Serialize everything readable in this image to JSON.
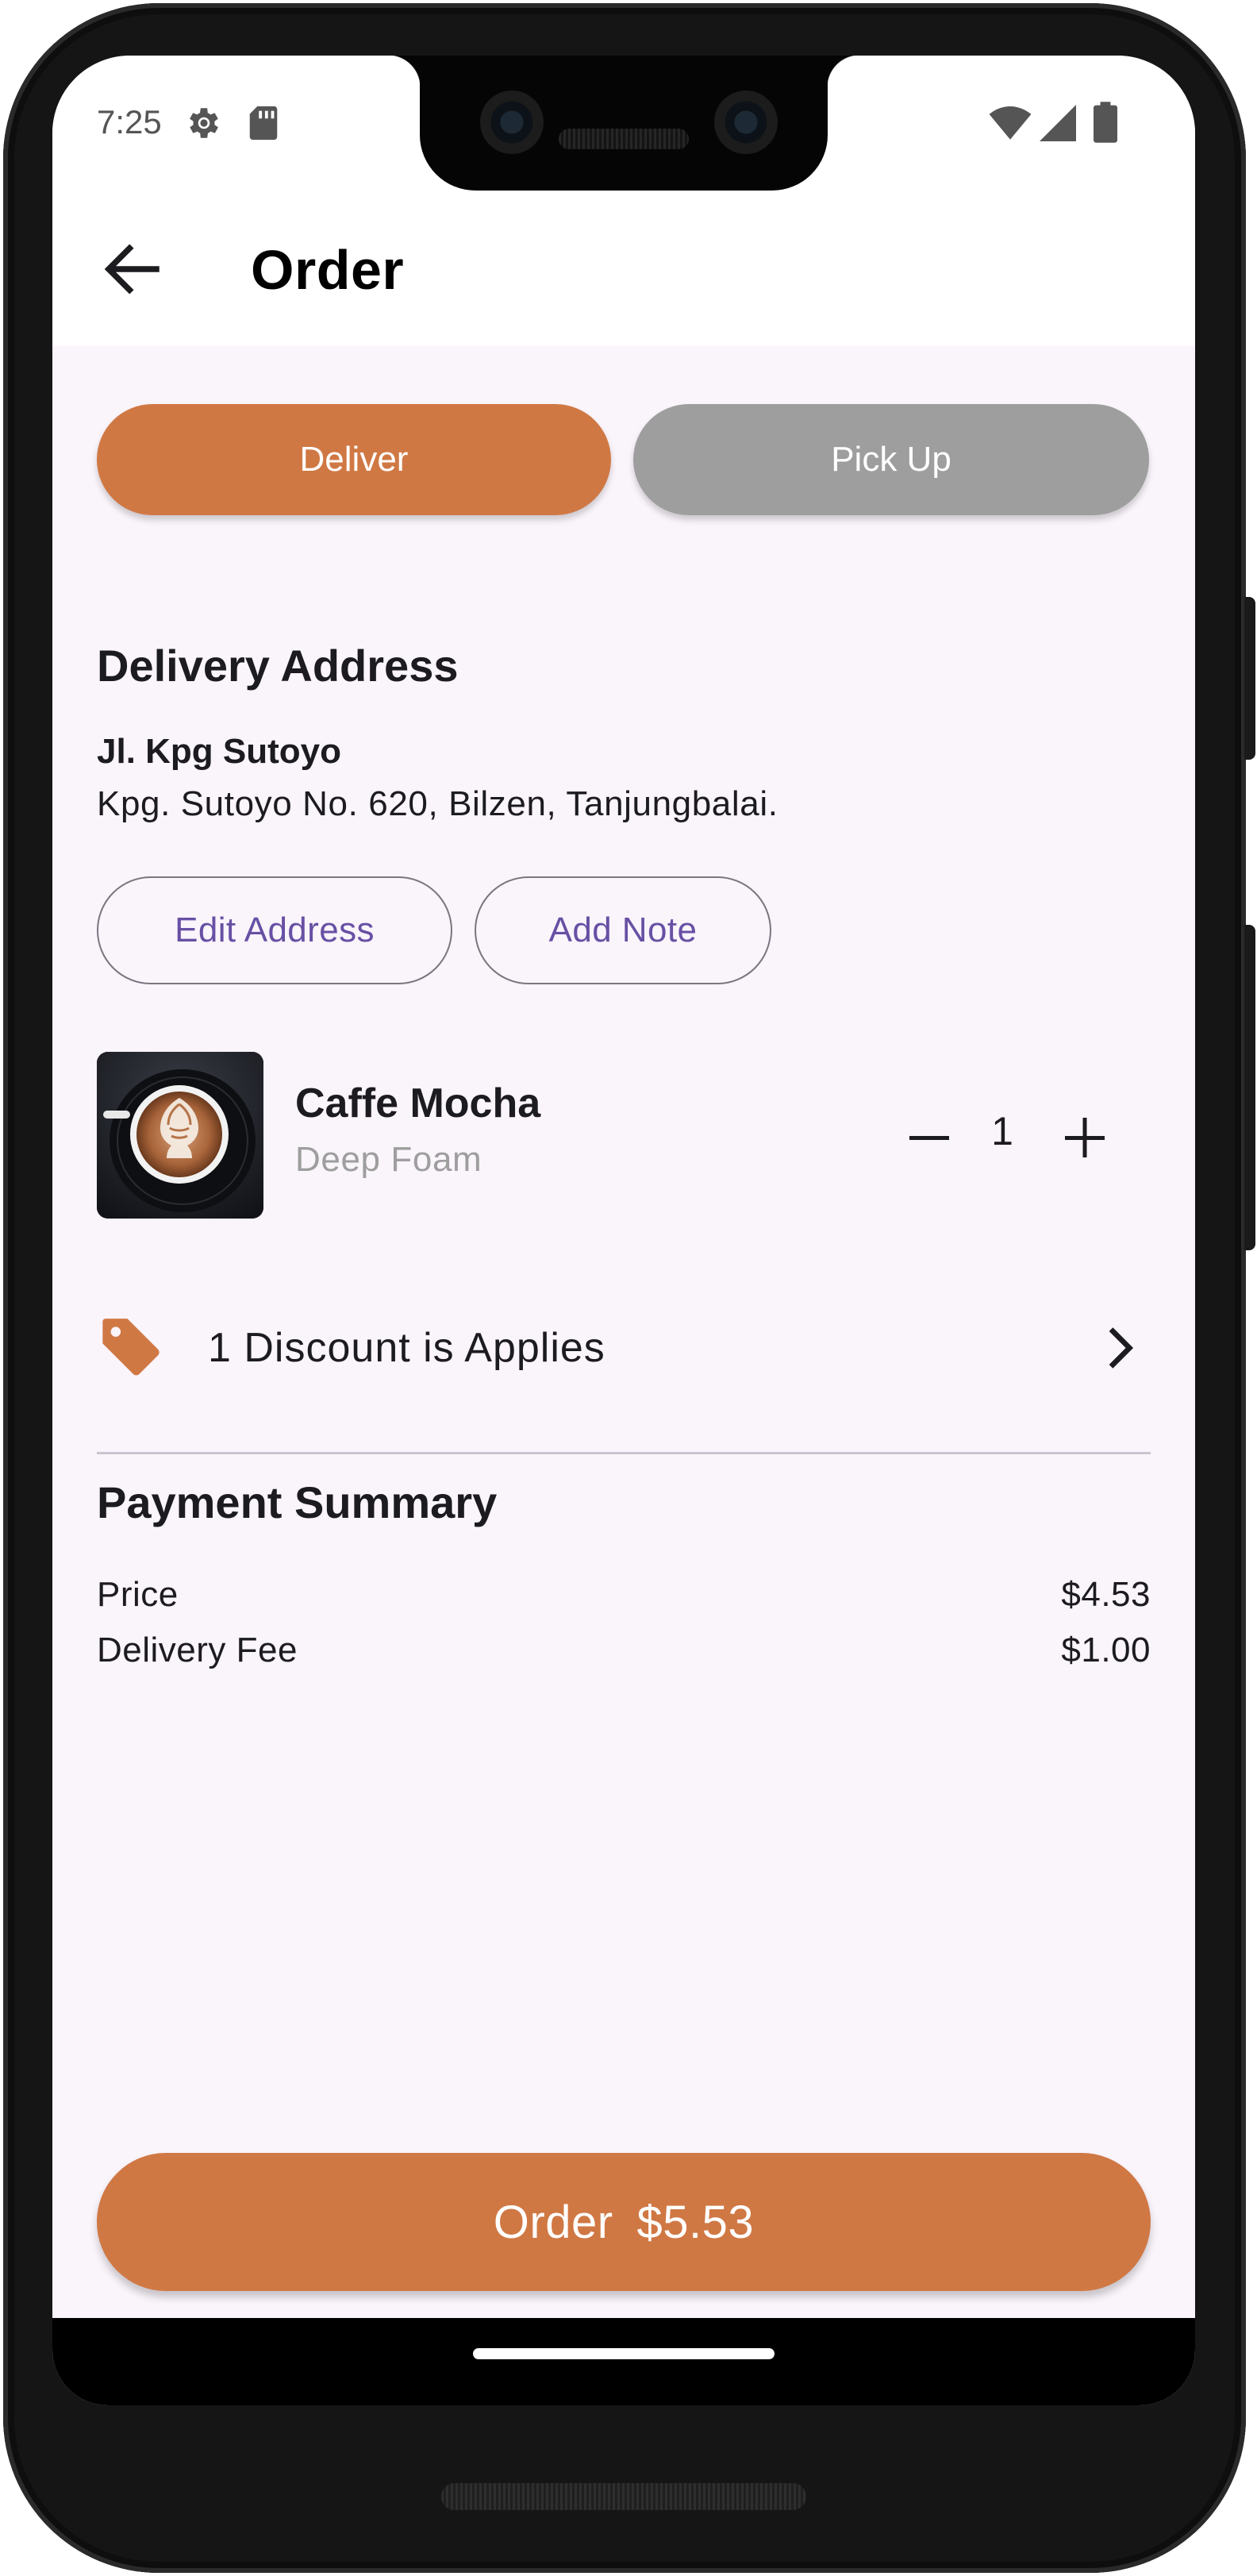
{
  "status_bar": {
    "time": "7:25",
    "icons": [
      "settings-icon",
      "sd-card-icon",
      "wifi-icon",
      "signal-icon",
      "battery-icon"
    ]
  },
  "app_bar": {
    "back_icon": "arrow-back-icon",
    "title": "Order"
  },
  "mode_toggle": {
    "deliver_label": "Deliver",
    "pickup_label": "Pick Up",
    "selected": "Deliver"
  },
  "delivery": {
    "section_title": "Delivery Address",
    "address_name": "Jl. Kpg Sutoyo",
    "address_line": "Kpg. Sutoyo No. 620, Bilzen, Tanjungbalai.",
    "edit_label": "Edit Address",
    "note_label": "Add Note"
  },
  "item": {
    "image_icon": "coffee-latte-art-image",
    "name": "Caffe Mocha",
    "subtitle": "Deep Foam",
    "quantity": "1"
  },
  "discount": {
    "icon": "tag-icon",
    "text": "1 Discount is Applies"
  },
  "payment": {
    "section_title": "Payment Summary",
    "rows": [
      {
        "label": "Price",
        "value": "$4.53"
      },
      {
        "label": "Delivery Fee",
        "value": "$1.00"
      }
    ]
  },
  "order_button": {
    "label": "Order",
    "total": "$5.53"
  },
  "colors": {
    "accent": "#d07844",
    "inactive": "#9e9e9e",
    "background": "#faf4fb",
    "outline_text": "#6750a4"
  }
}
